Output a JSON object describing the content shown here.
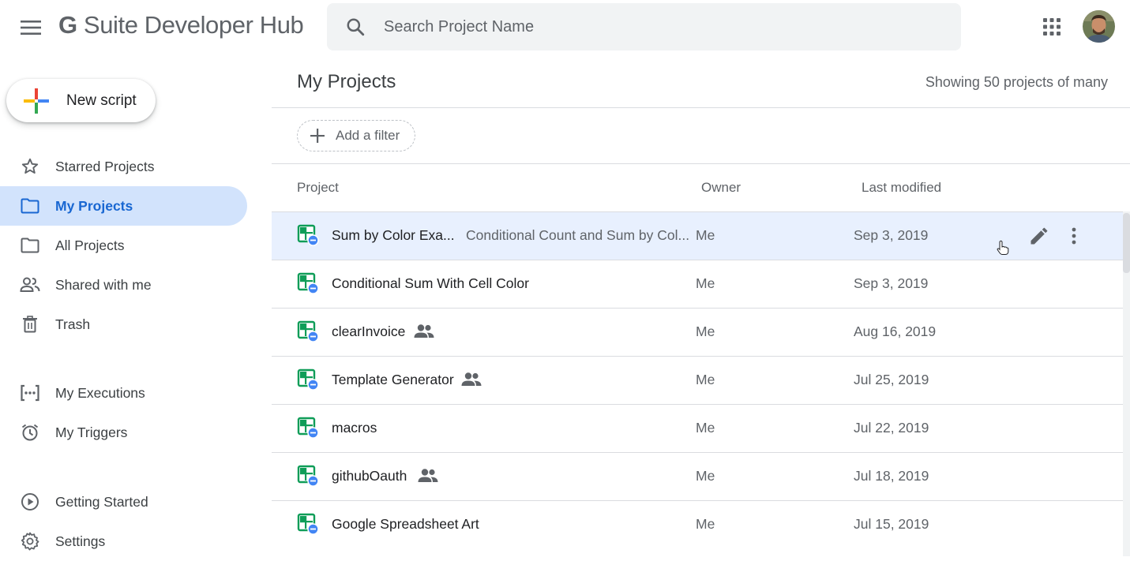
{
  "topbar": {
    "brand_g": "G",
    "brand_rest": " Suite Developer Hub",
    "search_placeholder": "Search Project Name"
  },
  "sidebar": {
    "new_script_label": "New script",
    "items": [
      {
        "label": "Starred Projects",
        "icon": "star-icon"
      },
      {
        "label": "My Projects",
        "icon": "folder-icon",
        "active": true
      },
      {
        "label": "All Projects",
        "icon": "folder-icon"
      },
      {
        "label": "Shared with me",
        "icon": "people-icon"
      },
      {
        "label": "Trash",
        "icon": "trash-icon"
      },
      {
        "label": "My Executions",
        "icon": "executions-icon"
      },
      {
        "label": "My Triggers",
        "icon": "alarm-icon"
      },
      {
        "label": "Getting Started",
        "icon": "play-circle-icon"
      },
      {
        "label": "Settings",
        "icon": "gear-icon"
      }
    ]
  },
  "main": {
    "title": "My Projects",
    "showing": "Showing 50 projects of many",
    "filter_label": "Add a filter",
    "columns": {
      "project": "Project",
      "owner": "Owner",
      "modified": "Last modified"
    },
    "rows": [
      {
        "name": "Sum by Color Exa...",
        "desc": "Conditional Count and Sum by Col...",
        "owner": "Me",
        "date": "Sep 3, 2019",
        "shared": false,
        "selected": true
      },
      {
        "name": "Conditional Sum With Cell Color",
        "desc": "",
        "owner": "Me",
        "date": "Sep 3, 2019",
        "shared": false
      },
      {
        "name": "clearInvoice",
        "desc": "",
        "owner": "Me",
        "date": "Aug 16, 2019",
        "shared": true
      },
      {
        "name": "Template Generator",
        "desc": "",
        "owner": "Me",
        "date": "Jul 25, 2019",
        "shared": true
      },
      {
        "name": "macros",
        "desc": "",
        "owner": "Me",
        "date": "Jul 22, 2019",
        "shared": false
      },
      {
        "name": "githubOauth",
        "desc": "",
        "owner": "Me",
        "date": "Jul 18, 2019",
        "shared": true
      },
      {
        "name": "Google Spreadsheet Art",
        "desc": "",
        "owner": "Me",
        "date": "Jul 15, 2019",
        "shared": false
      }
    ]
  },
  "colors": {
    "active_bg": "#d2e3fc",
    "active_text": "#1967d2",
    "selected_row_bg": "#e8f0fe",
    "sheets_green": "#0f9d58",
    "script_blue": "#4285f4"
  }
}
